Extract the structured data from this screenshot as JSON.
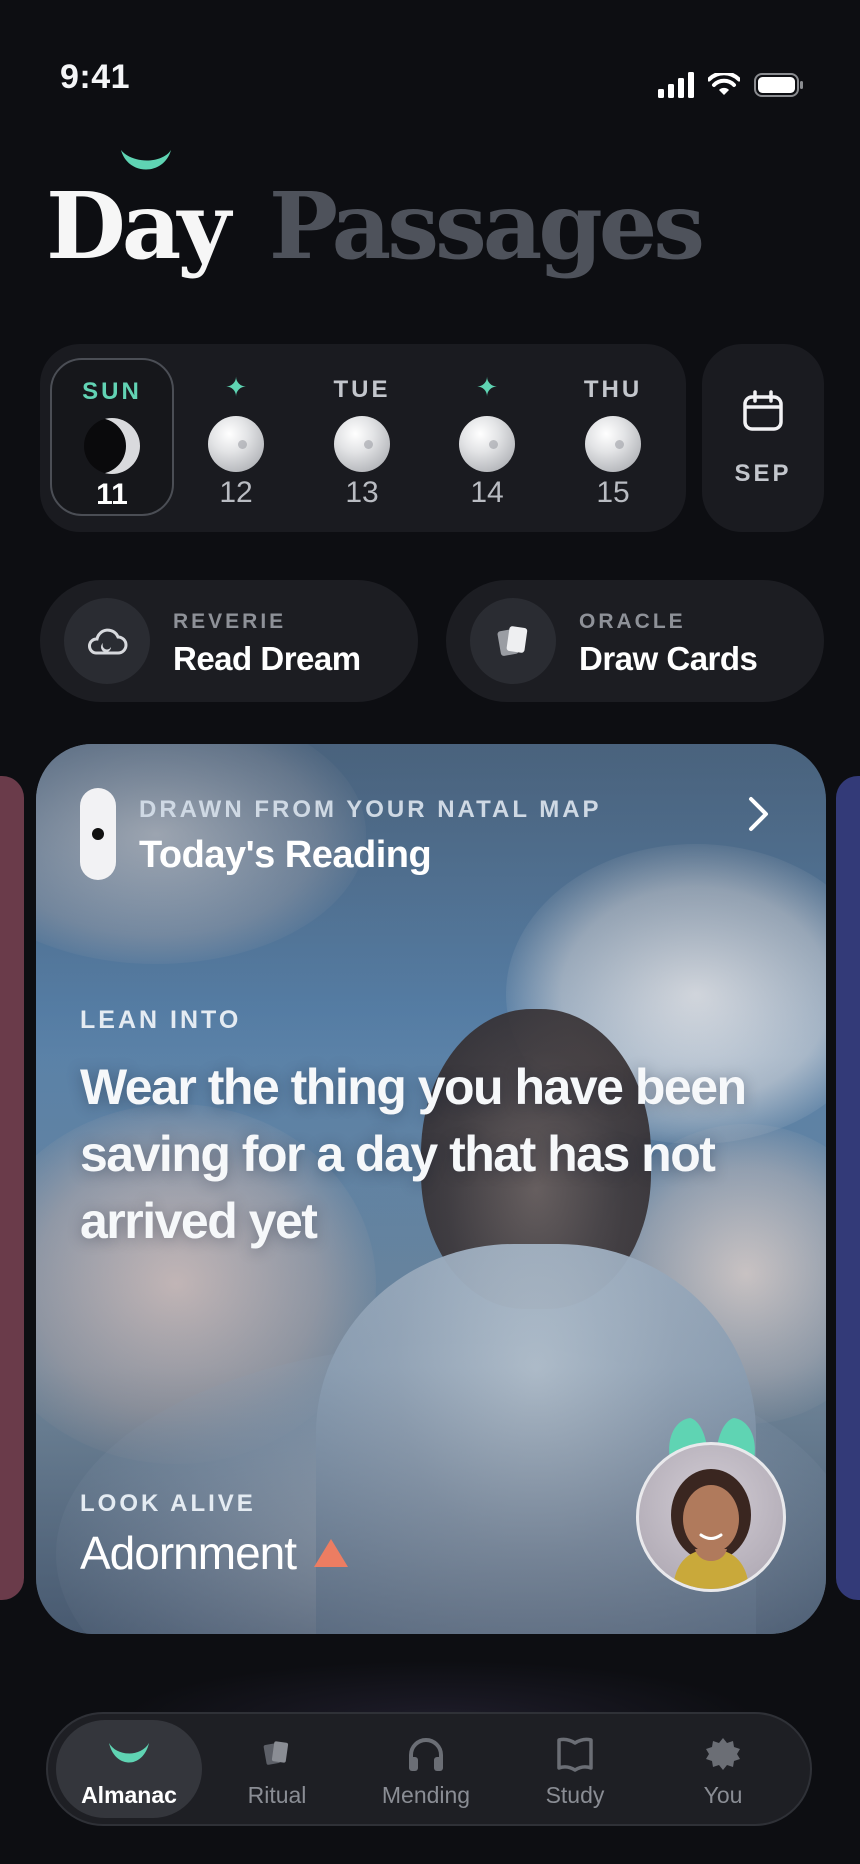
{
  "status_bar": {
    "time": "9:41"
  },
  "header": {
    "title_part1": "Day",
    "title_part2": "Passages"
  },
  "calendar": {
    "days": [
      {
        "name": "SUN",
        "number": "11",
        "selected": true,
        "phase": "crescent"
      },
      {
        "name": "",
        "number": "12",
        "starred": true,
        "phase": "full"
      },
      {
        "name": "TUE",
        "number": "13",
        "phase": "full"
      },
      {
        "name": "",
        "number": "14",
        "starred": true,
        "phase": "full"
      },
      {
        "name": "THU",
        "number": "15",
        "phase": "full"
      }
    ],
    "star_glyph": "✦",
    "month_label": "SEP"
  },
  "actions": [
    {
      "kicker": "REVERIE",
      "label": "Read Dream",
      "icon": "cloud-moon-icon"
    },
    {
      "kicker": "ORACLE",
      "label": "Draw Cards",
      "icon": "cards-icon"
    }
  ],
  "reading_card": {
    "kicker": "DRAWN FROM YOUR NATAL MAP",
    "title": "Today's Reading",
    "lean_label": "LEAN INTO",
    "quote": "Wear the thing you have been saving for a day that has not arrived yet",
    "look_label": "LOOK ALIVE",
    "theme": "Adornment",
    "accent_color": "#ec7d62"
  },
  "tabbar": {
    "tabs": [
      {
        "label": "Almanac",
        "icon": "moon-arc-icon",
        "active": true
      },
      {
        "label": "Ritual",
        "icon": "cards-icon"
      },
      {
        "label": "Mending",
        "icon": "headphones-icon"
      },
      {
        "label": "Study",
        "icon": "book-icon"
      },
      {
        "label": "You",
        "icon": "badge-icon"
      }
    ]
  },
  "colors": {
    "accent": "#5fd4b3",
    "background": "#0d0e12"
  }
}
